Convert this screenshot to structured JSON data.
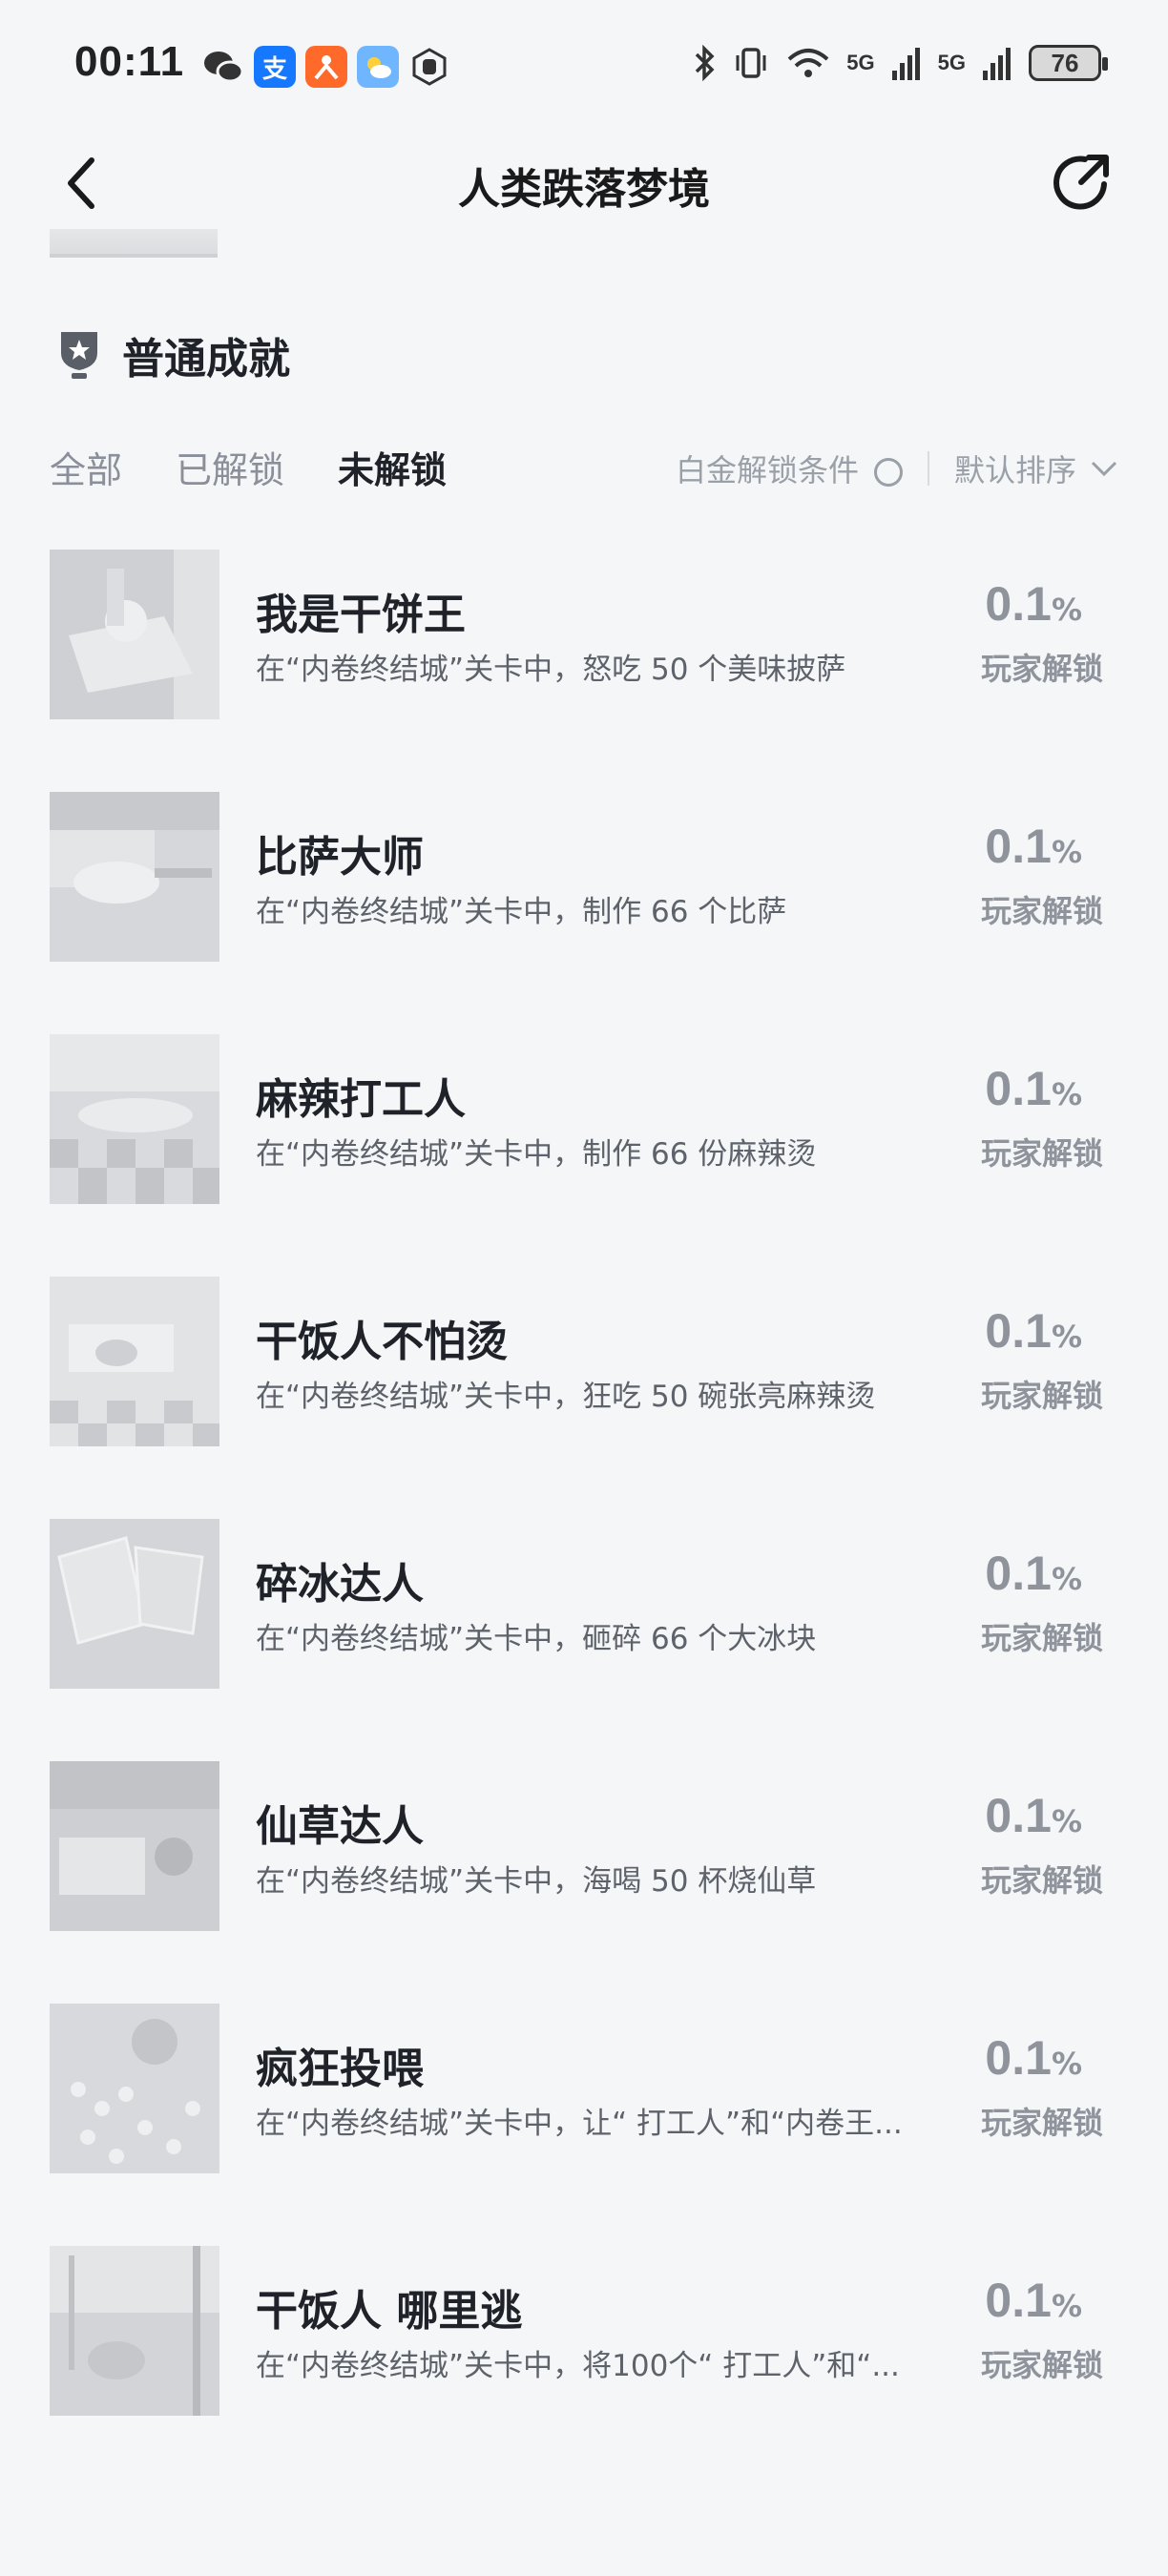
{
  "status_bar": {
    "time": "00:11",
    "battery": "76",
    "signal_1": "5G",
    "signal_2": "5G"
  },
  "header": {
    "title": "人类跌落梦境"
  },
  "section": {
    "title": "普通成就"
  },
  "tabs": [
    {
      "label": "全部"
    },
    {
      "label": "已解锁"
    },
    {
      "label": "未解锁"
    }
  ],
  "filters": {
    "platinum_label": "白金解锁条件",
    "sort_label": "默认排序"
  },
  "achievements": [
    {
      "title": "我是干饼王",
      "desc": "在“内卷终结城”关卡中，怒吃 50 个美味披萨",
      "pct": "0.1",
      "pct_symbol": "%",
      "pct_label": "玩家解锁"
    },
    {
      "title": "比萨大师",
      "desc": "在“内卷终结城”关卡中，制作 66 个比萨",
      "pct": "0.1",
      "pct_symbol": "%",
      "pct_label": "玩家解锁"
    },
    {
      "title": "麻辣打工人",
      "desc": "在“内卷终结城”关卡中，制作 66 份麻辣烫",
      "pct": "0.1",
      "pct_symbol": "%",
      "pct_label": "玩家解锁"
    },
    {
      "title": "干饭人不怕烫",
      "desc": "在“内卷终结城”关卡中，狂吃 50 碗张亮麻辣烫",
      "pct": "0.1",
      "pct_symbol": "%",
      "pct_label": "玩家解锁"
    },
    {
      "title": "碎冰达人",
      "desc": "在“内卷终结城”关卡中，砸碎 66 个大冰块",
      "pct": "0.1",
      "pct_symbol": "%",
      "pct_label": "玩家解锁"
    },
    {
      "title": "仙草达人",
      "desc": "在“内卷终结城”关卡中，海喝 50 杯烧仙草",
      "pct": "0.1",
      "pct_symbol": "%",
      "pct_label": "玩家解锁"
    },
    {
      "title": "疯狂投喂",
      "desc": "在“内卷终结城”关卡中，让“ 打工人”和“内卷王...",
      "pct": "0.1",
      "pct_symbol": "%",
      "pct_label": "玩家解锁"
    },
    {
      "title": "干饭人 哪里逃",
      "desc": "在“内卷终结城”关卡中，将100个“ 打工人”和“...",
      "pct": "0.1",
      "pct_symbol": "%",
      "pct_label": "玩家解锁"
    }
  ],
  "colors": {
    "background": "#f5f6f8",
    "text_primary": "#1f2329",
    "text_muted": "#8f949c"
  }
}
